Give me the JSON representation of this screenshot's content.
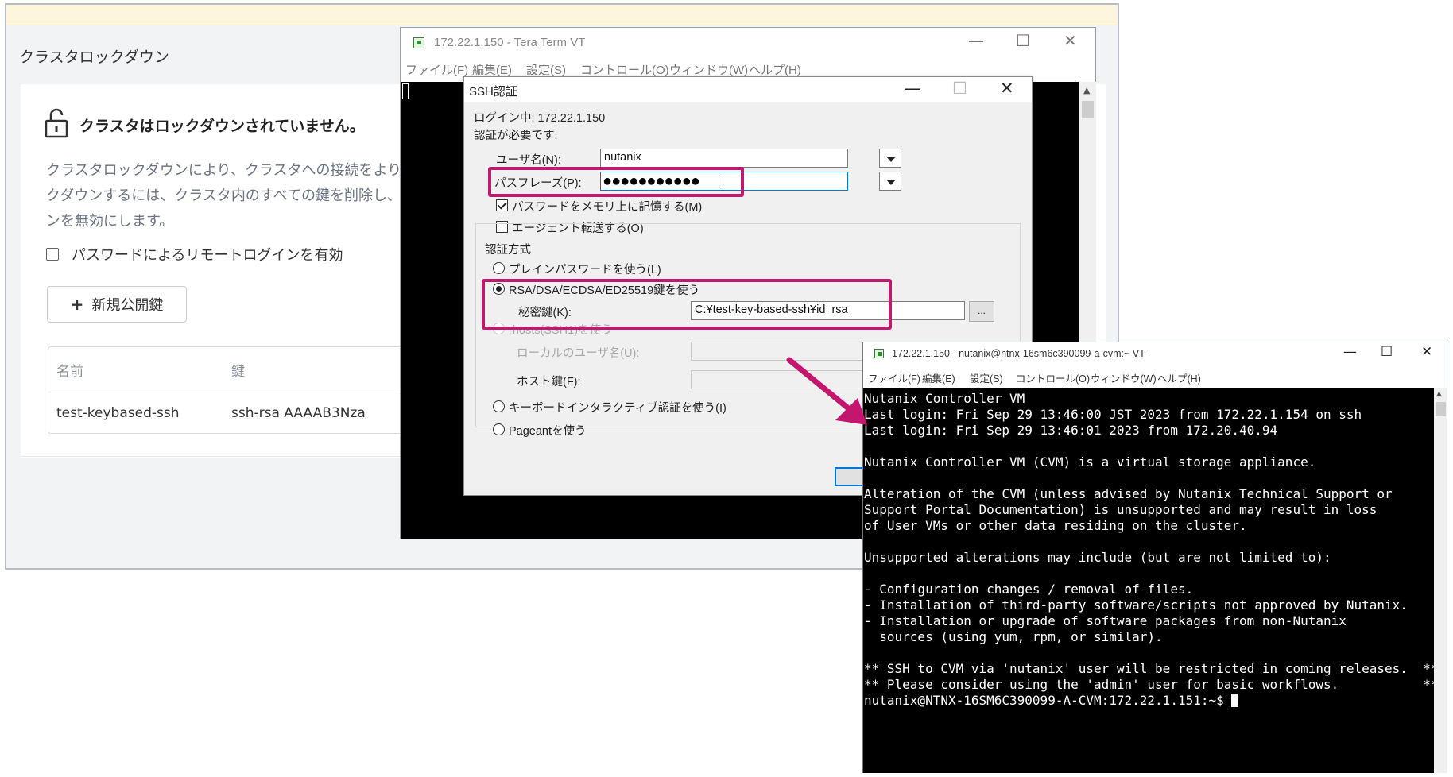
{
  "web": {
    "page_title": "クラスタロックダウン",
    "lock_status": "クラスタはロックダウンされていません。",
    "description_lines": [
      "クラスタロックダウンにより、クラスタへの接続をよりセキュアに",
      "クダウンするには、クラスタ内のすべての鍵を削除し、パスワ",
      "ンを無効にします。"
    ],
    "password_login_label": "パスワードによるリモートログインを有効",
    "new_key_button": "新規公開鍵",
    "table": {
      "headers": [
        "名前",
        "鍵"
      ],
      "rows": [
        [
          "test-keybased-ssh",
          "ssh-rsa AAAAB3Nza"
        ]
      ]
    }
  },
  "teraterm": {
    "title": "172.22.1.150 - Tera Term VT",
    "menu": [
      "ファイル(F)",
      "編集(E)",
      "設定(S)",
      "コントロール(O)",
      "ウィンドウ(W)",
      "ヘルプ(H)"
    ]
  },
  "ssh_dialog": {
    "title": "SSH認証",
    "logging_in": "ログイン中: 172.22.1.150",
    "auth_required": "認証が必要です.",
    "username_label": "ユーザ名(N):",
    "username_value": "nutanix",
    "passphrase_label": "パスフレーズ(P):",
    "passphrase_value": "●●●●●●●●●●●",
    "remember_password": "パスワードをメモリ上に記憶する(M)",
    "remember_password_checked": true,
    "agent_forward": "エージェント転送する(O)",
    "agent_forward_checked": false,
    "auth_method_group": "認証方式",
    "method_plain": "プレインパスワードを使う(L)",
    "method_rsa": "RSA/DSA/ECDSA/ED25519鍵を使う",
    "private_key_label": "秘密鍵(K):",
    "private_key_value": "C:¥test-key-based-ssh¥id_rsa",
    "browse_button": "...",
    "method_rhosts": "rhosts(SSH1)を使う",
    "local_user_label": "ローカルのユーザ名(U):",
    "host_key_label": "ホスト鍵(F):",
    "method_keyboard": "キーボードインタラクティブ認証を使う(I)",
    "method_pageant": "Pageantを使う",
    "selected_method": "rsa"
  },
  "cvm": {
    "title": "172.22.1.150 - nutanix@ntnx-16sm6c390099-a-cvm:~ VT",
    "menu": [
      "ファイル(F)",
      "編集(E)",
      "設定(S)",
      "コントロール(O)",
      "ウィンドウ(W)",
      "ヘルプ(H)"
    ],
    "lines": [
      "Nutanix Controller VM",
      "Last login: Fri Sep 29 13:46:00 JST 2023 from 172.22.1.154 on ssh",
      "Last login: Fri Sep 29 13:46:01 2023 from 172.20.40.94",
      "",
      "Nutanix Controller VM (CVM) is a virtual storage appliance.",
      "",
      "Alteration of the CVM (unless advised by Nutanix Technical Support or",
      "Support Portal Documentation) is unsupported and may result in loss",
      "of User VMs or other data residing on the cluster.",
      "",
      "Unsupported alterations may include (but are not limited to):",
      "",
      "- Configuration changes / removal of files.",
      "- Installation of third-party software/scripts not approved by Nutanix.",
      "- Installation or upgrade of software packages from non-Nutanix",
      "  sources (using yum, rpm, or similar).",
      "",
      "** SSH to CVM via 'nutanix' user will be restricted in coming releases.  **",
      "** Please consider using the 'admin' user for basic workflows.           **"
    ],
    "prompt": "nutanix@NTNX-16SM6C390099-A-CVM:172.22.1.151:~$ "
  },
  "colors": {
    "highlight": "#be1a6e",
    "arrow": "#c4166e"
  }
}
